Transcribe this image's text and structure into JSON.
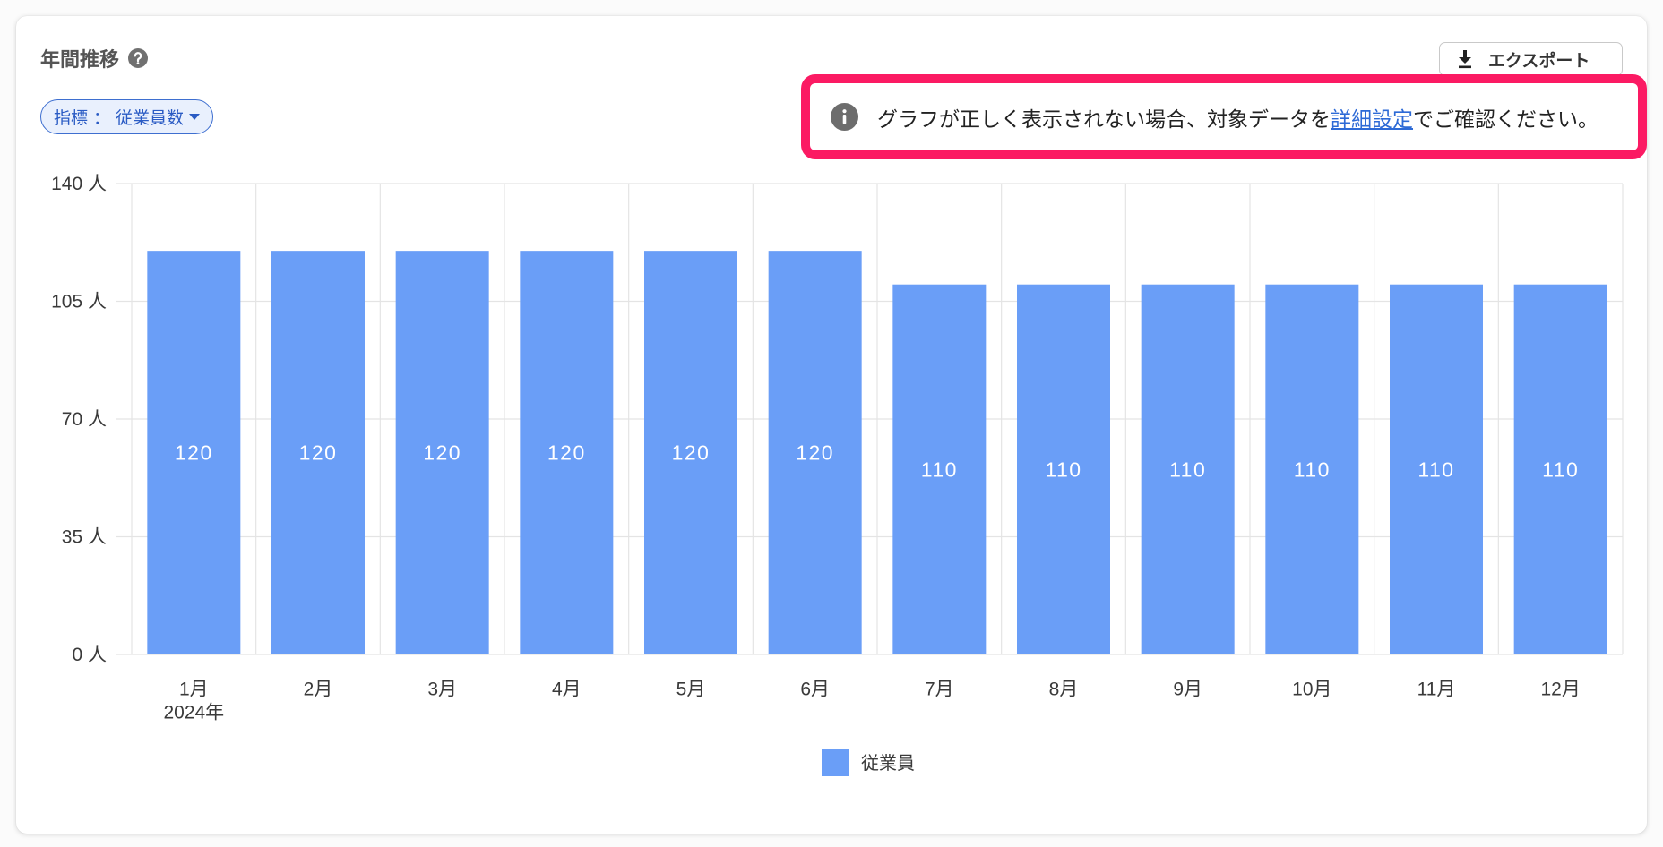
{
  "header": {
    "title": "年間推移",
    "help_icon": "help-circle-icon",
    "export": {
      "label": "エクスポート",
      "icon": "download-icon"
    }
  },
  "filter": {
    "label": "指標",
    "separator": "：",
    "value": "従業員数",
    "icon": "caret-down-icon"
  },
  "notice": {
    "icon": "info-circle-icon",
    "text_before": "グラフが正しく表示されない場合、対象データを",
    "link_label": "詳細設定",
    "text_after": "でご確認ください。"
  },
  "colors": {
    "highlight": "#fb1a63",
    "link": "#2d6ad6",
    "accent": "#3e6fd0"
  },
  "chart_data": {
    "type": "bar",
    "categories": [
      "1月",
      "2月",
      "3月",
      "4月",
      "5月",
      "6月",
      "7月",
      "8月",
      "9月",
      "10月",
      "11月",
      "12月"
    ],
    "year_label": "2024年",
    "series": [
      {
        "name": "従業員",
        "values": [
          120,
          120,
          120,
          120,
          120,
          120,
          110,
          110,
          110,
          110,
          110,
          110
        ],
        "color": "#6a9ef7"
      }
    ],
    "ylim": [
      0,
      140
    ],
    "yticks": [
      0,
      35,
      70,
      105,
      140
    ],
    "yunit": "人",
    "data_labels": true,
    "grid": true,
    "legend": "bottom-center"
  }
}
